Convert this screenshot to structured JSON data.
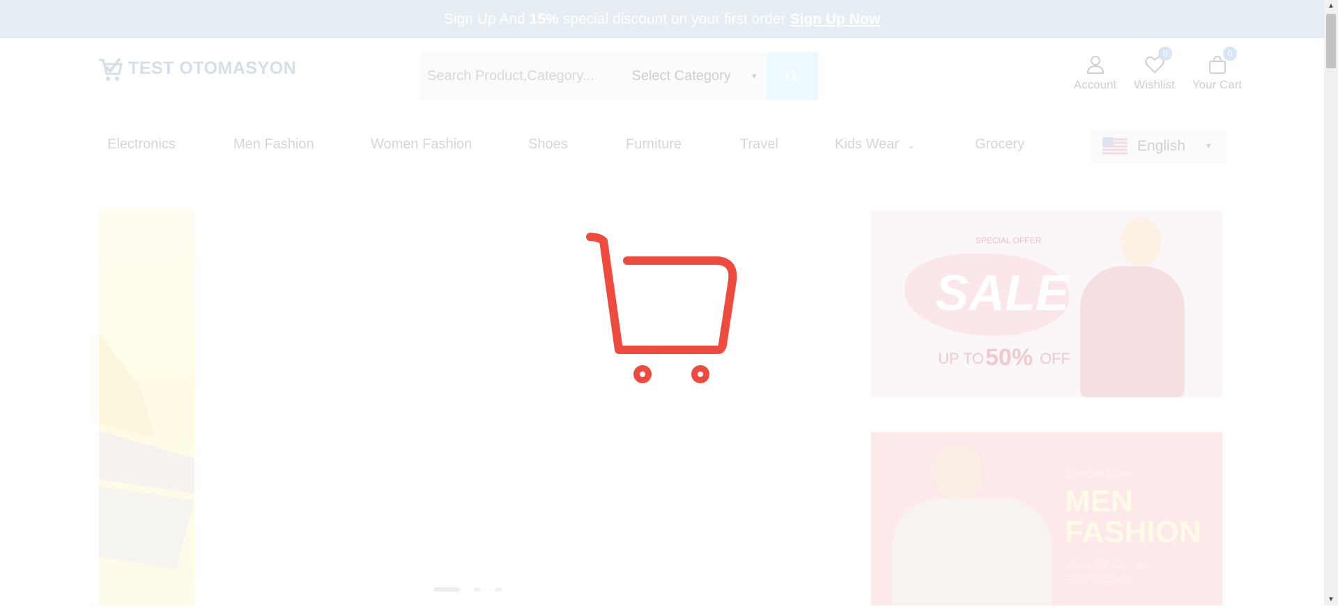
{
  "promo": {
    "text_pre": "Sign Up And",
    "discount": "15%",
    "text_post": "special discount on your first order",
    "link": "Sign Up Now"
  },
  "header": {
    "logo_text": "TEST OTOMASYON",
    "search_placeholder": "Search Product,Category...",
    "category_select": "Select Category",
    "account_label": "Account",
    "wishlist_label": "Wishlist",
    "wishlist_count": "0",
    "cart_label": "Your Cart",
    "cart_count": "0"
  },
  "nav": {
    "items": [
      "Electronics",
      "Men Fashion",
      "Women Fashion",
      "Shoes",
      "Furniture",
      "Travel",
      "Kids Wear",
      "Grocery"
    ],
    "language": "English"
  },
  "banners": {
    "sale": {
      "offer": "SPECIAL OFFER",
      "sale": "SALE",
      "upto": "UP TO",
      "percent": "50%",
      "off": "OFF"
    },
    "men": {
      "special": "Special Offer",
      "line1": "MEN",
      "line2": "FASHION",
      "sub1": "10% OFF On Your",
      "sub2": "First Purchase"
    }
  },
  "colors": {
    "loader_red": "#ee4b3e",
    "promo_bg": "#e6eef3"
  },
  "slider": {
    "active_index": 0,
    "count": 3
  }
}
